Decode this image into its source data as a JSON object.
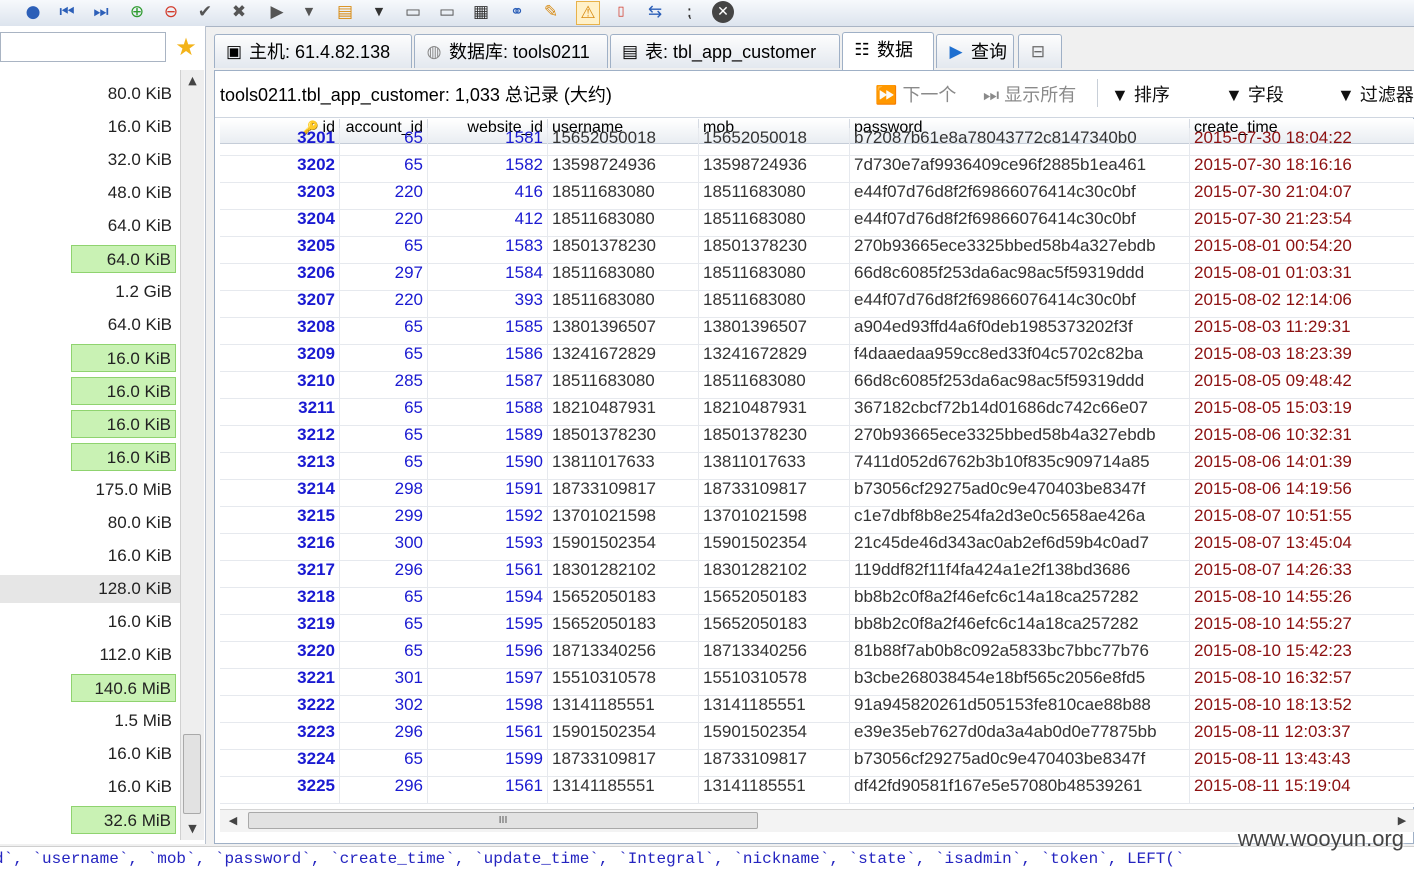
{
  "toolbar": {
    "icons": [
      "help-icon",
      "first-record-icon",
      "last-record-icon",
      "add-record-icon",
      "delete-record-icon",
      "apply-icon",
      "cancel-icon",
      "run-icon",
      "dropdown-icon",
      "query-builder-icon",
      "dropdown-icon",
      "save-icon",
      "save-as-icon",
      "grid-icon",
      "connect-icon",
      "edit-icon",
      "warning-icon",
      "export-icon",
      "refresh-icon",
      "pause-icon",
      "close-icon"
    ]
  },
  "sidebar": {
    "search_value": "",
    "sizes": [
      {
        "value": "80.0 KiB",
        "highlight": false
      },
      {
        "value": "16.0 KiB",
        "highlight": false
      },
      {
        "value": "32.0 KiB",
        "highlight": false
      },
      {
        "value": "48.0 KiB",
        "highlight": false
      },
      {
        "value": "64.0 KiB",
        "highlight": false
      },
      {
        "value": "64.0 KiB",
        "highlight": true
      },
      {
        "value": "1.2 GiB",
        "highlight": false
      },
      {
        "value": "64.0 KiB",
        "highlight": false
      },
      {
        "value": "16.0 KiB",
        "highlight": true
      },
      {
        "value": "16.0 KiB",
        "highlight": true
      },
      {
        "value": "16.0 KiB",
        "highlight": true
      },
      {
        "value": "16.0 KiB",
        "highlight": true
      },
      {
        "value": "175.0 MiB",
        "highlight": false
      },
      {
        "value": "80.0 KiB",
        "highlight": false
      },
      {
        "value": "16.0 KiB",
        "highlight": false
      },
      {
        "value": "128.0 KiB",
        "highlight": false,
        "selected": true
      },
      {
        "value": "16.0 KiB",
        "highlight": false
      },
      {
        "value": "112.0 KiB",
        "highlight": false
      },
      {
        "value": "140.6 MiB",
        "highlight": true
      },
      {
        "value": "1.5 MiB",
        "highlight": false
      },
      {
        "value": "16.0 KiB",
        "highlight": false
      },
      {
        "value": "16.0 KiB",
        "highlight": false
      },
      {
        "value": "32.6 MiB",
        "highlight": true
      }
    ]
  },
  "tabs": [
    {
      "label": "主机: 61.4.82.138",
      "icon": "server-icon",
      "active": false
    },
    {
      "label": "数据库: tools0211",
      "icon": "database-icon",
      "active": false
    },
    {
      "label": "表: tbl_app_customer",
      "icon": "table-icon",
      "active": false
    },
    {
      "label": "数据",
      "icon": "data-grid-icon",
      "active": true
    },
    {
      "label": "查询",
      "icon": "query-play-icon",
      "active": false
    },
    {
      "label": "",
      "icon": "new-query-tab-icon",
      "active": false
    }
  ],
  "infobar": {
    "summary": "tools0211.tbl_app_customer: 1,033 总记录 (大约)",
    "next": "下一个",
    "show_all": "显示所有",
    "sort": "排序",
    "columns": "字段",
    "filter": "过滤器"
  },
  "grid": {
    "columns": [
      "id",
      "account_id",
      "website_id",
      "username",
      "mob",
      "password",
      "create_time"
    ],
    "partial_row": [
      "3201",
      "65",
      "1581",
      "15652050018",
      "15652050018",
      "b72087b61e8a78043772c8147340b0",
      "2015-07-30 18:04:22"
    ],
    "rows": [
      [
        "3202",
        "65",
        "1582",
        "13598724936",
        "13598724936",
        "7d730e7af9936409ce96f2885b1ea461",
        "2015-07-30 18:16:16"
      ],
      [
        "3203",
        "220",
        "416",
        "18511683080",
        "18511683080",
        "e44f07d76d8f2f69866076414c30c0bf",
        "2015-07-30 21:04:07"
      ],
      [
        "3204",
        "220",
        "412",
        "18511683080",
        "18511683080",
        "e44f07d76d8f2f69866076414c30c0bf",
        "2015-07-30 21:23:54"
      ],
      [
        "3205",
        "65",
        "1583",
        "18501378230",
        "18501378230",
        "270b93665ece3325bbed58b4a327ebdb",
        "2015-08-01 00:54:20"
      ],
      [
        "3206",
        "297",
        "1584",
        "18511683080",
        "18511683080",
        "66d8c6085f253da6ac98ac5f59319ddd",
        "2015-08-01 01:03:31"
      ],
      [
        "3207",
        "220",
        "393",
        "18511683080",
        "18511683080",
        "e44f07d76d8f2f69866076414c30c0bf",
        "2015-08-02 12:14:06"
      ],
      [
        "3208",
        "65",
        "1585",
        "13801396507",
        "13801396507",
        "a904ed93ffd4a6f0deb1985373202f3f",
        "2015-08-03 11:29:31"
      ],
      [
        "3209",
        "65",
        "1586",
        "13241672829",
        "13241672829",
        "f4daaedaa959cc8ed33f04c5702c82ba",
        "2015-08-03 18:23:39"
      ],
      [
        "3210",
        "285",
        "1587",
        "18511683080",
        "18511683080",
        "66d8c6085f253da6ac98ac5f59319ddd",
        "2015-08-05 09:48:42"
      ],
      [
        "3211",
        "65",
        "1588",
        "18210487931",
        "18210487931",
        "367182cbcf72b14d01686dc742c66e07",
        "2015-08-05 15:03:19"
      ],
      [
        "3212",
        "65",
        "1589",
        "18501378230",
        "18501378230",
        "270b93665ece3325bbed58b4a327ebdb",
        "2015-08-06 10:32:31"
      ],
      [
        "3213",
        "65",
        "1590",
        "13811017633",
        "13811017633",
        "7411d052d6762b3b10f835c909714a85",
        "2015-08-06 14:01:39"
      ],
      [
        "3214",
        "298",
        "1591",
        "18733109817",
        "18733109817",
        "b73056cf29275ad0c9e470403be8347f",
        "2015-08-06 14:19:56"
      ],
      [
        "3215",
        "299",
        "1592",
        "13701021598",
        "13701021598",
        "c1e7dbf8b8e254fa2d3e0c5658ae426a",
        "2015-08-07 10:51:55"
      ],
      [
        "3216",
        "300",
        "1593",
        "15901502354",
        "15901502354",
        "21c45de46d343ac0ab2ef6d59b4c0ad7",
        "2015-08-07 13:45:04"
      ],
      [
        "3217",
        "296",
        "1561",
        "18301282102",
        "18301282102",
        "119ddf82f11f4fa424a1e2f138bd3686",
        "2015-08-07 14:26:33"
      ],
      [
        "3218",
        "65",
        "1594",
        "15652050183",
        "15652050183",
        "bb8b2c0f8a2f46efc6c14a18ca257282",
        "2015-08-10 14:55:26"
      ],
      [
        "3219",
        "65",
        "1595",
        "15652050183",
        "15652050183",
        "bb8b2c0f8a2f46efc6c14a18ca257282",
        "2015-08-10 14:55:27"
      ],
      [
        "3220",
        "65",
        "1596",
        "18713340256",
        "18713340256",
        "81b88f7ab0b8c092a5833bc7bbc77b76",
        "2015-08-10 15:42:23"
      ],
      [
        "3221",
        "301",
        "1597",
        "15510310578",
        "15510310578",
        "b3cbe268038454e18bf565c2056e8fd5",
        "2015-08-10 16:32:57"
      ],
      [
        "3222",
        "302",
        "1598",
        "13141185551",
        "13141185551",
        "91a945820261d505153fe810cae88b88",
        "2015-08-10 18:13:52"
      ],
      [
        "3223",
        "296",
        "1561",
        "15901502354",
        "15901502354",
        "e39e35eb7627d0da3a4ab0d0e77875bb",
        "2015-08-11 12:03:37"
      ],
      [
        "3224",
        "65",
        "1599",
        "18733109817",
        "18733109817",
        "b73056cf29275ad0c9e470403be8347f",
        "2015-08-11 13:43:43"
      ],
      [
        "3225",
        "296",
        "1561",
        "13141185551",
        "13141185551",
        "df42fd90581f167e5e57080b48539261",
        "2015-08-11 15:19:04"
      ]
    ]
  },
  "hscroll_thumb_label": "III",
  "sql_bar": "d`, `username`, `mob`, `password`, `create_time`, `update_time`, `Integral`, `nickname`, `state`, `isadmin`, `token`, LEFT(`",
  "watermark": "www.wooyun.org",
  "colors": {
    "highlight_green": "#c9f2b4",
    "id_blue": "#1a1ad1",
    "time_red": "#8c1010"
  }
}
